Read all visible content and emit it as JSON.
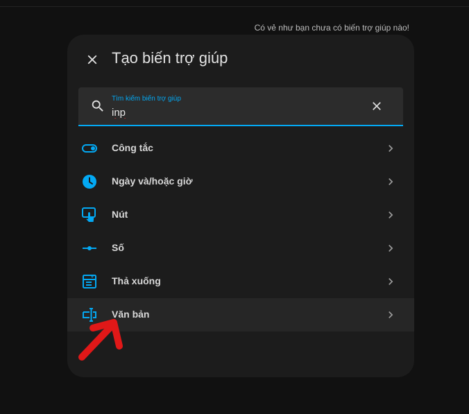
{
  "background": {
    "message": "Có vẻ như bạn chưa có biến trợ giúp nào!"
  },
  "dialog": {
    "title": "Tạo biến trợ giúp",
    "close_icon": "close-icon",
    "search": {
      "label": "Tìm kiếm biến trợ giúp",
      "value": "inp",
      "search_icon": "search-icon",
      "clear_icon": "clear-icon"
    },
    "items": [
      {
        "label": "Công tắc",
        "icon": "toggle-switch-icon"
      },
      {
        "label": "Ngày và/hoặc giờ",
        "icon": "clock-icon"
      },
      {
        "label": "Nút",
        "icon": "gesture-tap-button-icon"
      },
      {
        "label": "Số",
        "icon": "ray-vertex-icon"
      },
      {
        "label": "Thả xuống",
        "icon": "form-dropdown-icon"
      },
      {
        "label": "Văn bản",
        "icon": "form-textbox-icon"
      }
    ]
  },
  "colors": {
    "accent": "#03a9f4",
    "page_background": "#111111",
    "dialog_background": "#1c1c1c",
    "annotation_arrow": "#e01818"
  }
}
